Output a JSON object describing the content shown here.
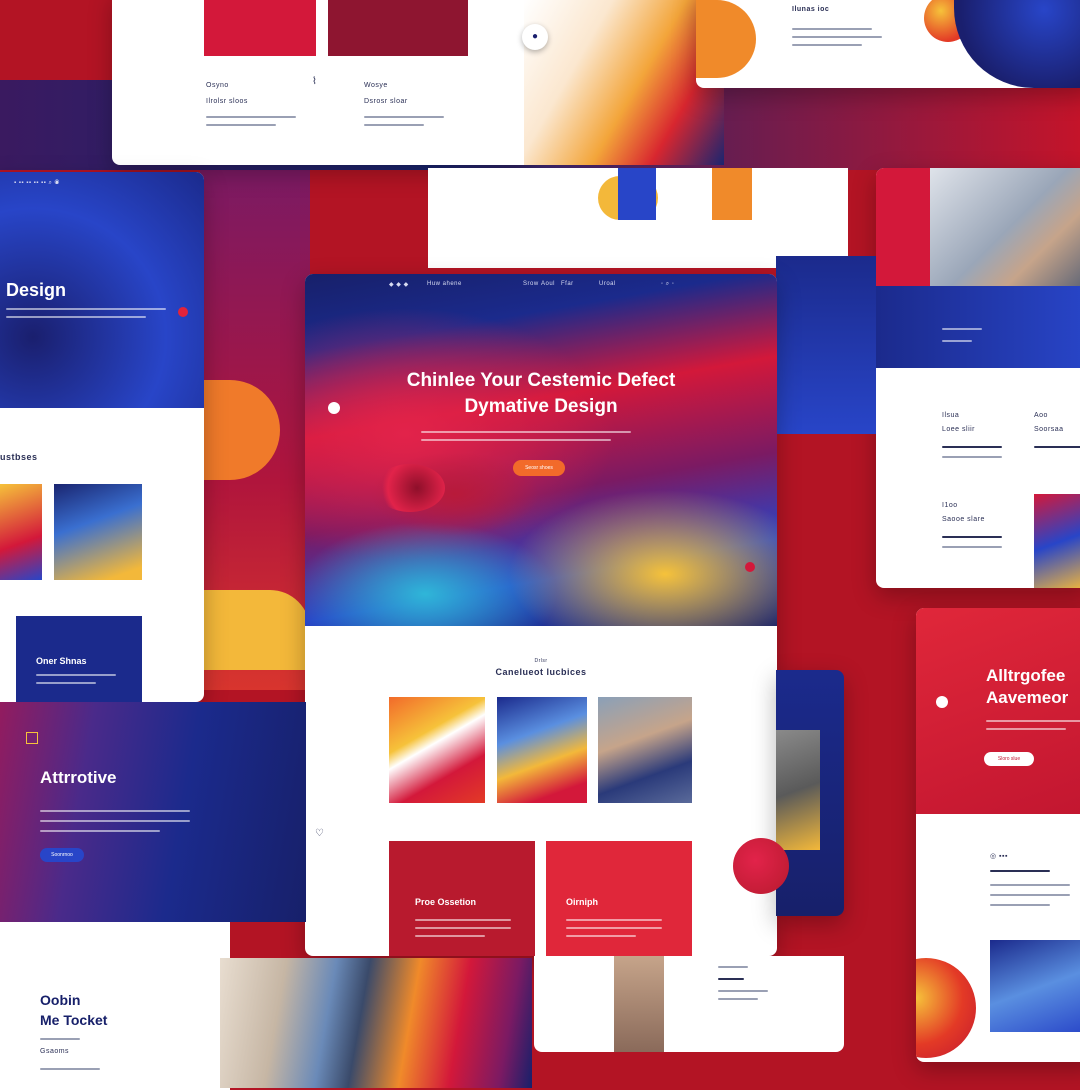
{
  "collage": {
    "colors": {
      "red": "#d3183a",
      "navy": "#1a1f6e",
      "blue": "#2845c8",
      "orange": "#f58a2a",
      "yellow": "#f6c23a",
      "purple": "#7b1a63"
    }
  },
  "top_left": {
    "c1_title": "Osyno",
    "c1_sub": "Ilrolsr sloos",
    "c2_title": "Wosye",
    "c2_sub": "Dsrosr sloar"
  },
  "top_right": {
    "heading": "Ilunas ioc"
  },
  "left_panel": {
    "hero_title": "Design",
    "section_title": "ustbses",
    "feature_title": "Oner Shnas"
  },
  "main_card": {
    "nav_brand": "Huw ahene",
    "nav_links": [
      "Srow",
      "Aoul",
      "Ffar",
      "Uroal"
    ],
    "hero_line1": "Chinlee Your Cestemic Defect",
    "hero_line2": "Dymative Design",
    "hero_button": "Seosr shoes",
    "section_eyebrow": "Drlsr",
    "section_title": "Canelueot lucbices",
    "block1_title": "Proe Ossetion",
    "block2_title": "Oirniph"
  },
  "right_panel": {
    "col1_title": "Ilsua",
    "col1_sub": "Loee sliir",
    "col2_title": "Aoo",
    "col2_sub": "Soorsaa",
    "row2_title": "I1oo",
    "row2_sub": "Saooe slare"
  },
  "right_red": {
    "title_line1": "Alltrgofee",
    "title_line2": "Aavemeor",
    "button": "Sloro slue"
  },
  "bottom_left": {
    "title": "Attrrotive",
    "button": "Soonrnoo"
  },
  "bottom_text": {
    "line1": "Oobin",
    "line2": "Me Tocket",
    "sub": "Gsaoms"
  }
}
